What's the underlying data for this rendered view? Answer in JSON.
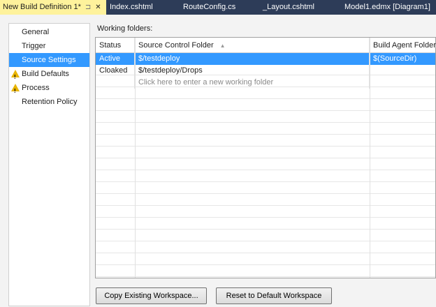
{
  "tabs": [
    {
      "label": "New Build Definition 1*",
      "active": true
    },
    {
      "label": "Index.cshtml"
    },
    {
      "label": "RouteConfig.cs"
    },
    {
      "label": "_Layout.cshtml"
    },
    {
      "label": "Model1.edmx [Diagram1]"
    }
  ],
  "tab_icons": {
    "pin": "⊐",
    "close": "✕"
  },
  "sidebar": [
    {
      "label": "General"
    },
    {
      "label": "Trigger"
    },
    {
      "label": "Source Settings",
      "selected": true
    },
    {
      "label": "Build Defaults",
      "warning": true
    },
    {
      "label": "Process",
      "warning": true
    },
    {
      "label": "Retention Policy"
    }
  ],
  "working_folders_label": "Working folders:",
  "columns": [
    "Status",
    "Source Control Folder",
    "Build Agent Folder"
  ],
  "sort_icon": "▲",
  "rows": [
    {
      "status": "Active",
      "source": "$/testdeploy",
      "agent": "$(SourceDir)"
    },
    {
      "status": "Cloaked",
      "source": "$/testdeploy/Drops",
      "agent": ""
    }
  ],
  "new_row_hint": "Click here to enter a new working folder",
  "buttons": {
    "copy": "Copy Existing Workspace...",
    "reset": "Reset to Default Workspace"
  }
}
